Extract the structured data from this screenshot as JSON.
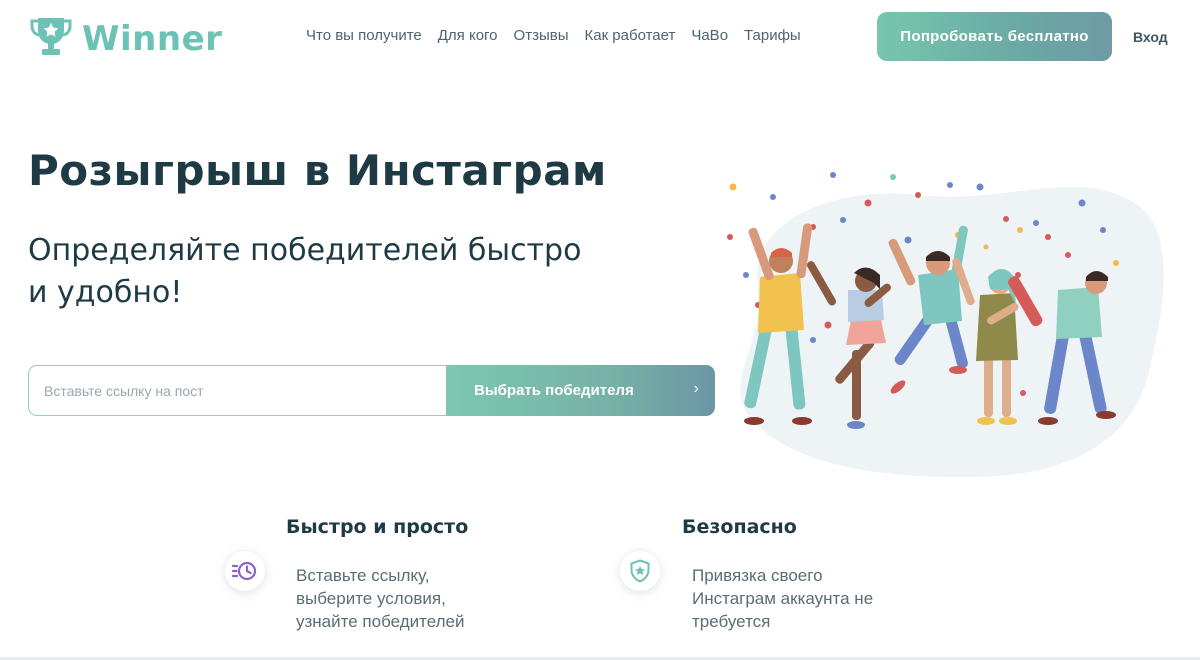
{
  "brand": {
    "name": "Winner",
    "accent": "#6cc2b4",
    "logo_icon": "trophy-star-icon"
  },
  "nav": [
    {
      "label": "Что вы получите"
    },
    {
      "label": "Для кого"
    },
    {
      "label": "Отзывы"
    },
    {
      "label": "Как работает"
    },
    {
      "label": "ЧаВо"
    },
    {
      "label": "Тарифы"
    }
  ],
  "header": {
    "cta_label": "Попробовать бесплатно",
    "login_label": "Вход"
  },
  "hero": {
    "title": "Розыгрыш в Инстаграм",
    "subtitle_line1": "Определяйте победителей быстро",
    "subtitle_line2": "и удобно!",
    "input_placeholder": "Вставьте ссылку на пост",
    "button_label": "Выбрать победителя",
    "button_icon": "chevron-right-icon"
  },
  "features": [
    {
      "title": "Быстро и просто",
      "icon": "fast-clock-icon",
      "lines": [
        "Вставьте ссылку,",
        "выберите условия,",
        "узнайте победителей"
      ]
    },
    {
      "title": "Безопасно",
      "icon": "shield-star-icon",
      "lines": [
        "Привязка своего",
        "Инстаграм аккаунта не",
        "требуется"
      ]
    }
  ],
  "colors": {
    "dark_text": "#1d3a45",
    "button_gradient_start": "#78c6ad",
    "button_gradient_end": "#6c96a6",
    "icon_purple": "#8e63c9",
    "icon_teal": "#6cc2b4"
  }
}
